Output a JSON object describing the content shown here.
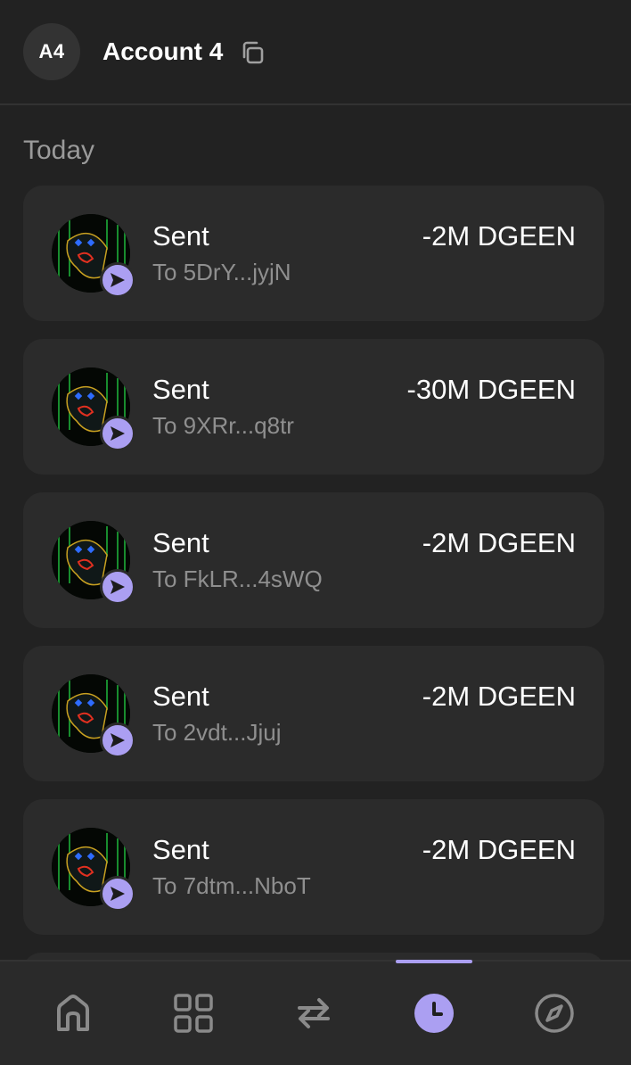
{
  "header": {
    "avatar_initials": "A4",
    "account_name": "Account 4",
    "copy_icon": "copy-icon"
  },
  "section": {
    "label": "Today"
  },
  "transactions": [
    {
      "title": "Sent",
      "subtitle": "To 5DrY...jyjN",
      "amount": "-2M DGEEN"
    },
    {
      "title": "Sent",
      "subtitle": "To 9XRr...q8tr",
      "amount": "-30M DGEEN"
    },
    {
      "title": "Sent",
      "subtitle": "To FkLR...4sWQ",
      "amount": "-2M DGEEN"
    },
    {
      "title": "Sent",
      "subtitle": "To 2vdt...Jjuj",
      "amount": "-2M DGEEN"
    },
    {
      "title": "Sent",
      "subtitle": "To 7dtm...NboT",
      "amount": "-2M DGEEN"
    }
  ],
  "nav": {
    "items": [
      "home-icon",
      "apps-grid-icon",
      "swap-icon",
      "activity-clock-icon",
      "explore-compass-icon"
    ],
    "active_index": 3
  },
  "colors": {
    "background": "#222222",
    "card": "#2b2b2b",
    "accent": "#ab9ff2",
    "secondary_text": "#8f8f8f"
  }
}
